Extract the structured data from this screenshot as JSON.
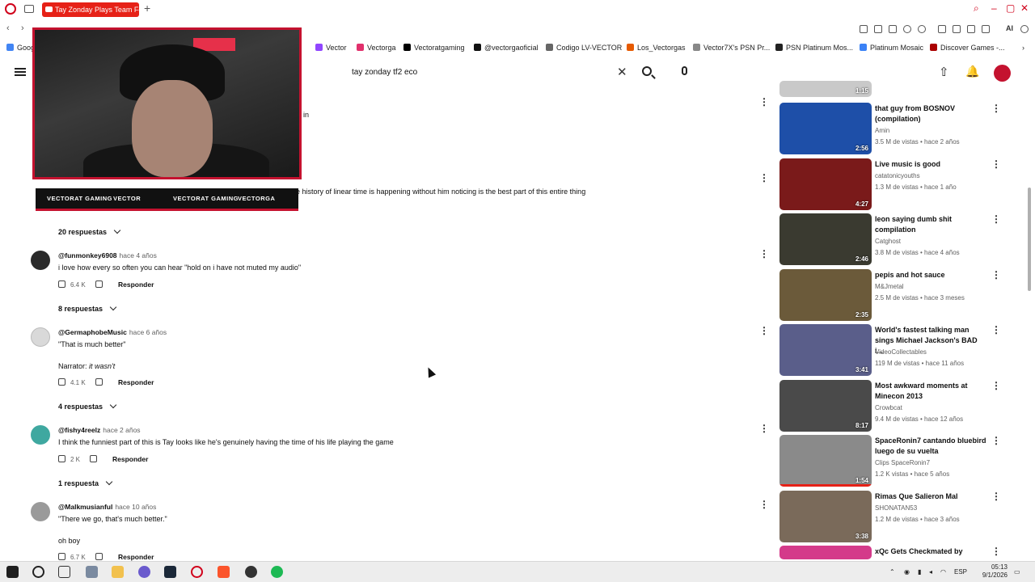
{
  "browser": {
    "tab_title": "Tay Zonday Plays Team Fo",
    "bookmarks": [
      "Googl",
      "Vector",
      "Vectorga",
      "Vectoratgaming",
      "@vectorgaoficial",
      "Codigo LV-VECTOR",
      "Los_Vectorgas",
      "Vector7X's PSN Pr...",
      "PSN Platinum Mos...",
      "Platinum Mosaic",
      "Discover Games -..."
    ],
    "ai_label": "AI"
  },
  "youtube": {
    "search_value": "tay zonday tf2 eco"
  },
  "overlay": {
    "socials": [
      "VECTORAT GAMING",
      "VECTOR",
      "VECTORAT GAMING",
      "VECTORGA"
    ]
  },
  "comments": {
    "first_fragment": "in",
    "top_comment_text": "e history of linear time is happening without him noticing is the best part of this entire thing",
    "top_comment_replies": "20 respuestas",
    "items": [
      {
        "handle": "@funmonkey6908",
        "age": "hace 4 años",
        "text": "i love how every so often you can hear \"hold on i have not muted my audio\"",
        "likes": "6.4 K",
        "reply": "Responder",
        "replies": "8 respuestas"
      },
      {
        "handle": "@GermaphobeMusic",
        "age": "hace 6 años",
        "text": "\"That is much better\"",
        "text2": "Narrator: ",
        "text2_italic": "it wasn't",
        "likes": "4.1 K",
        "reply": "Responder",
        "replies": "4 respuestas"
      },
      {
        "handle": "@fishy4reelz",
        "age": "hace 2 años",
        "text": "I think the funniest part of this is Tay looks like he's genuinely having the time of his life playing the game",
        "likes": "2 K",
        "reply": "Responder",
        "replies": "1 respuesta"
      },
      {
        "handle": "@Malkmusianful",
        "age": "hace 10 años",
        "text": "\"There we go, that's much better.\"",
        "text2": "oh boy",
        "likes": "6.7 K",
        "reply": "Responder"
      }
    ]
  },
  "sidebar": {
    "first_duration": "1:15",
    "videos": [
      {
        "title": "that guy from BOSNOV (compilation)",
        "channel": "Amin",
        "meta": "3.5 M de vistas • hace 2 años",
        "duration": "2:56",
        "color": "#1e4fa8"
      },
      {
        "title": "Live music is good",
        "channel": "catatonicyouths",
        "meta": "1.3 M de vistas • hace 1 año",
        "duration": "4:27",
        "color": "#7a1a1a"
      },
      {
        "title": "leon saying dumb shit compilation",
        "channel": "Catghost",
        "meta": "3.8 M de vistas • hace 4 años",
        "duration": "2:46",
        "color": "#3a3a30"
      },
      {
        "title": "pepis and hot sauce",
        "channel": "M&Jmetal",
        "meta": "2.5 M de vistas • hace 3 meses",
        "duration": "2:35",
        "color": "#6b5a3a"
      },
      {
        "title": "World's fastest talking man sings Michael Jackson's BAD i...",
        "channel": "VideoCollectables",
        "meta": "119 M de vistas • hace 11 años",
        "duration": "3:41",
        "color": "#5a5e8a"
      },
      {
        "title": "Most awkward moments at Minecon 2013",
        "channel": "Crowbcat",
        "meta": "9.4 M de vistas • hace 12 años",
        "duration": "8:17",
        "color": "#4a4a4a"
      },
      {
        "title": "SpaceRonin7 cantando bluebird luego de su vuelta",
        "channel": "Clips SpaceRonin7",
        "meta": "1.2 K vistas • hace 5 años",
        "duration": "1:54",
        "color": "#8a8a8a"
      },
      {
        "title": "Rimas Que Salieron Mal",
        "channel": "SHONATAN53",
        "meta": "1.2 M de vistas • hace 3 años",
        "duration": "3:38",
        "color": "#7a6a5a"
      },
      {
        "title": "xQc Gets Checkmated by",
        "channel": "",
        "meta": "",
        "duration": "",
        "color": "#d43a8a"
      }
    ]
  },
  "taskbar": {
    "lang": "ESP",
    "time": "05:13",
    "date": "9/1/2026"
  }
}
